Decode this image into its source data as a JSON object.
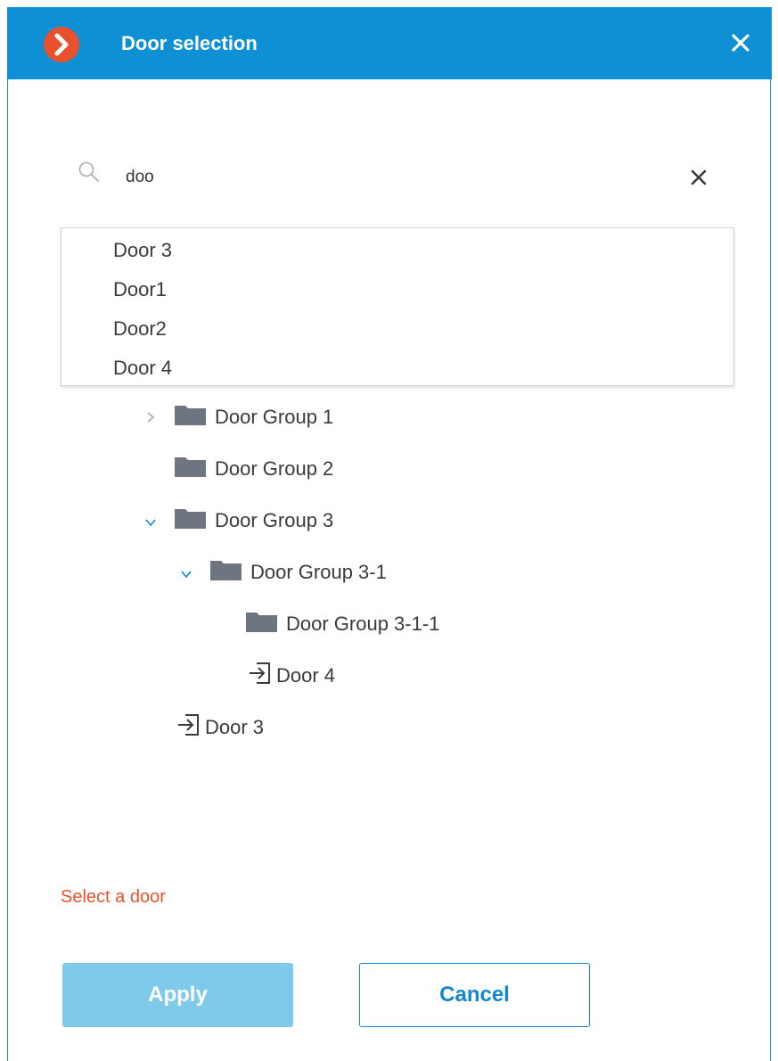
{
  "dialog": {
    "title": "Door selection"
  },
  "search": {
    "value": "doo"
  },
  "suggestions": [
    "Door 3",
    "Door1",
    "Door2",
    "Door 4"
  ],
  "tree": {
    "items": [
      {
        "label": "Door Group 1",
        "type": "folder",
        "expander": "collapsed"
      },
      {
        "label": "Door Group 2",
        "type": "folder",
        "expander": "none"
      },
      {
        "label": "Door Group 3",
        "type": "folder",
        "expander": "expanded"
      },
      {
        "label": "Door Group 3-1",
        "type": "folder",
        "expander": "expanded"
      },
      {
        "label": "Door Group 3-1-1",
        "type": "folder",
        "expander": "none"
      },
      {
        "label": "Door 4",
        "type": "door",
        "expander": "none"
      },
      {
        "label": "Door 3",
        "type": "door",
        "expander": "none"
      }
    ]
  },
  "validation": {
    "message": "Select a door"
  },
  "buttons": {
    "apply_label": "Apply",
    "cancel_label": "Cancel"
  },
  "colors": {
    "titlebar": "#0f8fd4",
    "logo": "#e8512b",
    "error": "#e8512b",
    "apply_disabled": "#7fc9ea",
    "cancel_border": "#1287cf",
    "folder": "#6e7480",
    "chevron_expanded": "#1287cf"
  },
  "icons": {
    "logo": "chevron-right-circle-icon",
    "close": "close-icon",
    "search": "search-icon",
    "clear": "clear-icon",
    "folder": "folder-icon",
    "door": "door-enter-icon"
  }
}
